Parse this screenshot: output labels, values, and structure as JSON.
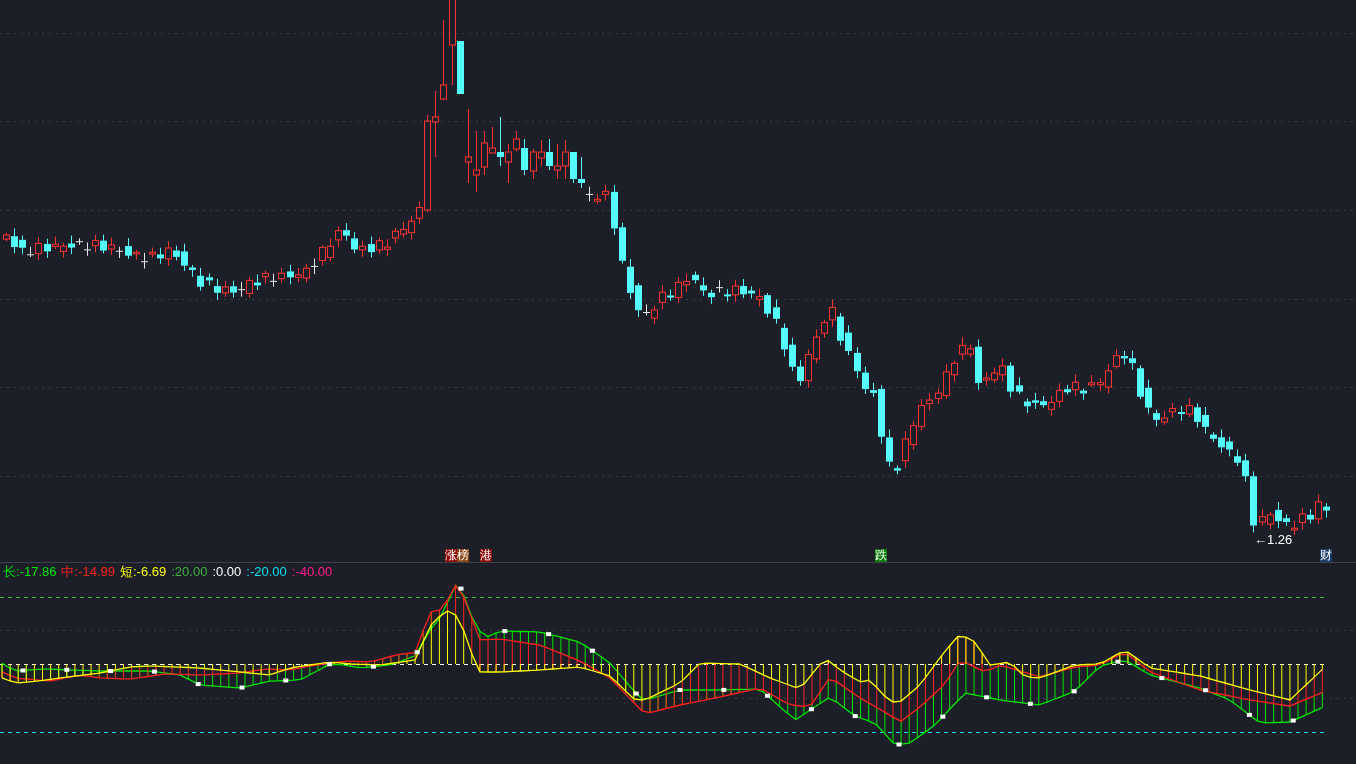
{
  "main_chart": {
    "signals": [
      {
        "label": "涨",
        "color": "#8b0a0a"
      },
      {
        "label": "榜",
        "color": "#8b4513"
      },
      {
        "label": "港",
        "color": "#8b0a0a"
      },
      {
        "label": "跌",
        "color": "#0a7d0a"
      },
      {
        "label": "财",
        "color": "#1c3e6e"
      }
    ],
    "low_price_label": "←1.26"
  },
  "indicator": {
    "legend": [
      {
        "label": "长:-17.86",
        "color": "#00e600"
      },
      {
        "label": "中:-14.99",
        "color": "#ff2020"
      },
      {
        "label": "短:-6.69",
        "color": "#ffff00"
      },
      {
        "label": ":20.00",
        "color": "#3cb43c"
      },
      {
        "label": ":0.00",
        "color": "#ffffff"
      },
      {
        "label": ":-20.00",
        "color": "#00e5ee"
      },
      {
        "label": ":-40.00",
        "color": "#ff1a8c"
      }
    ]
  }
}
